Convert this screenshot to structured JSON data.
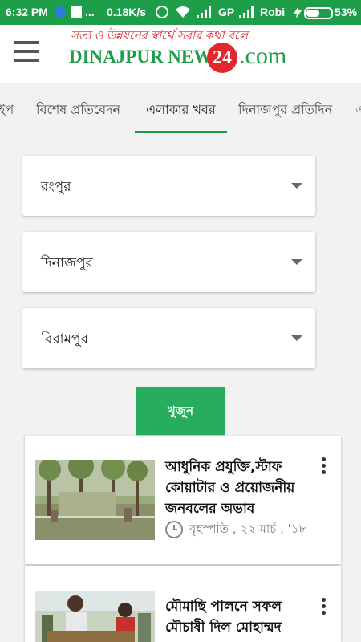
{
  "status_bar": {
    "time": "6:32 PM",
    "speed": "0.18K/s",
    "carrier1": "GP",
    "carrier2": "Robi",
    "battery": "53%"
  },
  "header": {
    "tagline": "সত্য ও উন্নয়নের স্বার্থে সবার কথা বলে",
    "logo_text": "DINAJPUR NEWS",
    "logo_number": "24",
    "logo_suffix": ".com"
  },
  "tabs": [
    {
      "label": "ইপ"
    },
    {
      "label": "বিশেষ প্রতিবেদন"
    },
    {
      "label": "এলাকার খবর",
      "active": true
    },
    {
      "label": "দিনাজপুর প্রতিদিন"
    }
  ],
  "filters": [
    {
      "value": "রংপুর"
    },
    {
      "value": "দিনাজপুর"
    },
    {
      "value": "বিরামপুর"
    }
  ],
  "search_button": "খুজুন",
  "articles": [
    {
      "title": "আধুনিক প্রযুক্তি,স্টাফ কোয়াটার ও প্রয়োজনীয় জনবলের অভাব",
      "date": "বৃহস্পতি , ২২ মার্চ , '১৮"
    },
    {
      "title": "মৌমাছি পালনে সফল মৌচাষী দিল মোহাম্মদ",
      "date": ""
    }
  ],
  "colors": {
    "status_bar": "#1e9e49",
    "accent_green": "#1f9e4a",
    "logo_red": "#e0282e",
    "button_green": "#27ad5e"
  }
}
